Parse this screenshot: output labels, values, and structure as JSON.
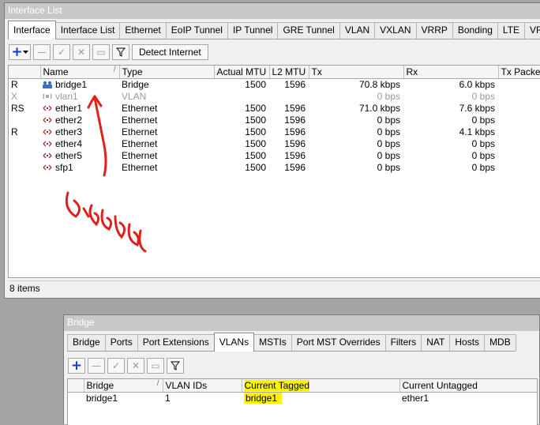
{
  "interface_window": {
    "title": "Interface List",
    "tabs": [
      {
        "label": "Interface"
      },
      {
        "label": "Interface List"
      },
      {
        "label": "Ethernet"
      },
      {
        "label": "EoIP Tunnel"
      },
      {
        "label": "IP Tunnel"
      },
      {
        "label": "GRE Tunnel"
      },
      {
        "label": "VLAN"
      },
      {
        "label": "VXLAN"
      },
      {
        "label": "VRRP"
      },
      {
        "label": "Bonding"
      },
      {
        "label": "LTE"
      },
      {
        "label": "VRF"
      }
    ],
    "toolbar": {
      "add_icon": "plus-icon",
      "dropdown_icon": "chevron-down-icon",
      "remove_icon": "minus-icon",
      "enable_icon": "check-icon",
      "disable_icon": "cross-icon",
      "comment_icon": "comment-icon",
      "filter_icon": "filter-icon",
      "detect_label": "Detect Internet"
    },
    "columns": [
      "",
      "Name",
      "Type",
      "Actual MTU",
      "L2 MTU",
      "Tx",
      "Rx",
      "Tx Packet"
    ],
    "rows": [
      {
        "flag": "R",
        "name": "bridge1",
        "type": "Bridge",
        "mtu": "1500",
        "l2mtu": "1596",
        "tx": "70.8 kbps",
        "rx": "6.0 kbps",
        "icon": "bridge-icon",
        "disabled": false
      },
      {
        "flag": "X",
        "name": "vlan1",
        "type": "VLAN",
        "mtu": "",
        "l2mtu": "",
        "tx": "0 bps",
        "rx": "0 bps",
        "icon": "vlan-icon",
        "disabled": true
      },
      {
        "flag": "RS",
        "name": "ether1",
        "type": "Ethernet",
        "mtu": "1500",
        "l2mtu": "1596",
        "tx": "71.0 kbps",
        "rx": "7.6 kbps",
        "icon": "ethernet-icon",
        "disabled": false
      },
      {
        "flag": "",
        "name": "ether2",
        "type": "Ethernet",
        "mtu": "1500",
        "l2mtu": "1596",
        "tx": "0 bps",
        "rx": "0 bps",
        "icon": "ethernet-icon",
        "disabled": false
      },
      {
        "flag": "R",
        "name": "ether3",
        "type": "Ethernet",
        "mtu": "1500",
        "l2mtu": "1596",
        "tx": "0 bps",
        "rx": "4.1 kbps",
        "icon": "ethernet-icon",
        "disabled": false
      },
      {
        "flag": "",
        "name": "ether4",
        "type": "Ethernet",
        "mtu": "1500",
        "l2mtu": "1596",
        "tx": "0 bps",
        "rx": "0 bps",
        "icon": "ethernet-icon",
        "disabled": false
      },
      {
        "flag": "",
        "name": "ether5",
        "type": "Ethernet",
        "mtu": "1500",
        "l2mtu": "1596",
        "tx": "0 bps",
        "rx": "0 bps",
        "icon": "ethernet-icon",
        "disabled": false
      },
      {
        "flag": "",
        "name": "sfp1",
        "type": "Ethernet",
        "mtu": "1500",
        "l2mtu": "1596",
        "tx": "0 bps",
        "rx": "0 bps",
        "icon": "ethernet-icon",
        "disabled": false
      }
    ],
    "status": "8 items",
    "annotation": {
      "text": "disabled",
      "color": "#e0201c"
    }
  },
  "bridge_window": {
    "title": "Bridge",
    "tabs": [
      {
        "label": "Bridge"
      },
      {
        "label": "Ports"
      },
      {
        "label": "Port Extensions"
      },
      {
        "label": "VLANs"
      },
      {
        "label": "MSTIs"
      },
      {
        "label": "Port MST Overrides"
      },
      {
        "label": "Filters"
      },
      {
        "label": "NAT"
      },
      {
        "label": "Hosts"
      },
      {
        "label": "MDB"
      }
    ],
    "columns": [
      "",
      "Bridge",
      "VLAN IDs",
      "Current Tagged",
      "Current Untagged"
    ],
    "rows": [
      {
        "bridge": "bridge1",
        "vlan_ids": "1",
        "tagged": "bridge1",
        "untagged": "ether1"
      }
    ],
    "highlight_color": "#fff200"
  },
  "colors": {
    "accent_blue": "#1c39c8",
    "desktop": "#a4a4a4",
    "titlebar": "#c8c8c8"
  }
}
